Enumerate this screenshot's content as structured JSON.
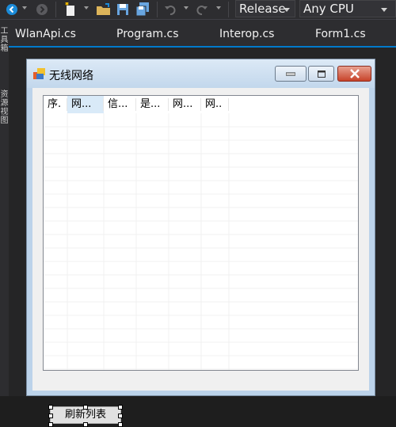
{
  "toolbar": {
    "icons": [
      "back-icon",
      "forward-icon",
      "new-item-icon",
      "open-folder-icon",
      "save-icon",
      "save-all-icon",
      "undo-icon",
      "redo-icon"
    ],
    "configuration": "Release",
    "platform": "Any CPU"
  },
  "side_panel": {
    "tabs": [
      "工具箱",
      "资源视图"
    ]
  },
  "document_tabs": [
    "WlanApi.cs",
    "Program.cs",
    "Interop.cs",
    "Form1.cs"
  ],
  "form": {
    "title": "无线网络",
    "list_columns": [
      "序.",
      "网...",
      "信...",
      "是...",
      "网...",
      "网.."
    ],
    "refresh_button": "刷新列表"
  },
  "colors": {
    "vs_background": "#1e1e1e",
    "vs_toolbar": "#2d2d30",
    "accent": "#007acc",
    "selected_column": "#d9eaf8",
    "close_button": "#c7432a"
  }
}
